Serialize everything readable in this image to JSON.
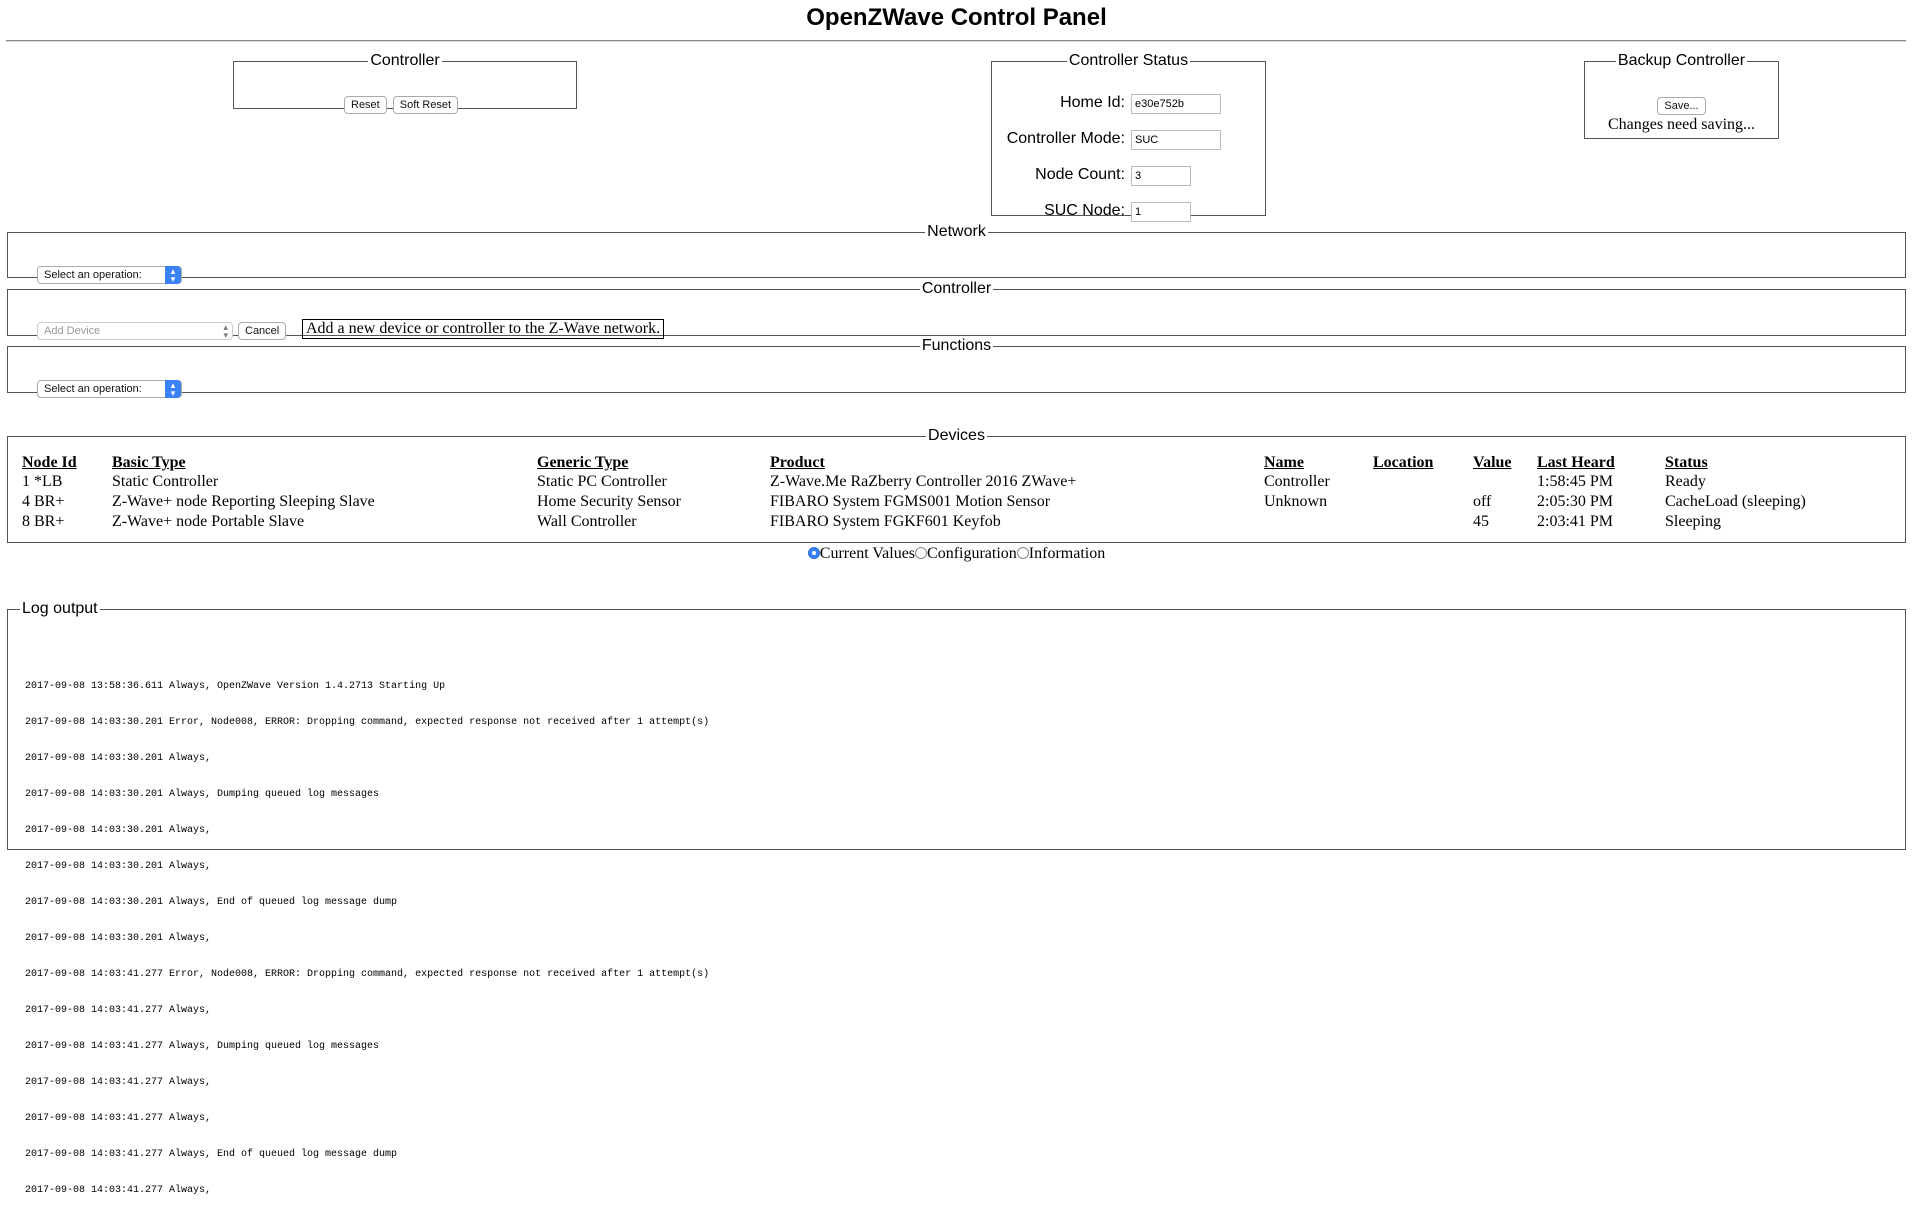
{
  "page": {
    "title": "OpenZWave Control Panel"
  },
  "controller_panel": {
    "legend": "Controller",
    "reset_label": "Reset",
    "soft_reset_label": "Soft Reset"
  },
  "controller_status": {
    "legend": "Controller Status",
    "home_id_label": "Home Id:",
    "home_id": "e30e752b",
    "mode_label": "Controller Mode:",
    "mode": "SUC",
    "node_count_label": "Node Count:",
    "node_count": "3",
    "suc_node_label": "SUC Node:",
    "suc_node": "1"
  },
  "backup_controller": {
    "legend": "Backup Controller",
    "save_label": "Save...",
    "message": "Changes need saving..."
  },
  "network": {
    "legend": "Network",
    "select_value": "Select an operation:"
  },
  "controller_ops": {
    "legend": "Controller",
    "select_value": "Add Device",
    "cancel_label": "Cancel",
    "description": "Add a new device or controller to the Z-Wave network."
  },
  "functions": {
    "legend": "Functions",
    "select_value": "Select an operation:"
  },
  "devices": {
    "legend": "Devices",
    "headers": {
      "node_id": "Node Id",
      "basic_type": "Basic Type",
      "generic_type": "Generic Type",
      "product": "Product",
      "name": "Name",
      "location": "Location",
      "value": "Value",
      "last_heard": "Last Heard",
      "status": "Status"
    },
    "rows": [
      {
        "node_id": "1 *LB",
        "basic_type": "Static Controller",
        "generic_type": "Static PC Controller",
        "product": "Z-Wave.Me RaZberry Controller 2016 ZWave+",
        "name": "Controller",
        "location": "",
        "value": "",
        "last_heard": "1:58:45 PM",
        "status": "Ready"
      },
      {
        "node_id": "4 BR+",
        "basic_type": "Z-Wave+ node Reporting Sleeping Slave",
        "generic_type": "Home Security Sensor",
        "product": "FIBARO System FGMS001 Motion Sensor",
        "name": "Unknown",
        "location": "",
        "value": "off",
        "last_heard": "2:05:30 PM",
        "status": "CacheLoad (sleeping)"
      },
      {
        "node_id": "8 BR+",
        "basic_type": "Z-Wave+ node Portable Slave",
        "generic_type": "Wall Controller",
        "product": "FIBARO System FGKF601 Keyfob",
        "name": "",
        "location": "",
        "value": "45",
        "last_heard": "2:03:41 PM",
        "status": "Sleeping"
      }
    ]
  },
  "view_options": {
    "selected": "Current Values",
    "options": [
      "Current Values",
      "Configuration",
      "Information"
    ]
  },
  "log": {
    "legend": "Log output",
    "lines": [
      "2017-09-08 13:58:36.611 Always, OpenZWave Version 1.4.2713 Starting Up",
      "2017-09-08 14:03:30.201 Error, Node008, ERROR: Dropping command, expected response not received after 1 attempt(s)",
      "2017-09-08 14:03:30.201 Always,",
      "2017-09-08 14:03:30.201 Always, Dumping queued log messages",
      "2017-09-08 14:03:30.201 Always,",
      "2017-09-08 14:03:30.201 Always,",
      "2017-09-08 14:03:30.201 Always, End of queued log message dump",
      "2017-09-08 14:03:30.201 Always,",
      "2017-09-08 14:03:41.277 Error, Node008, ERROR: Dropping command, expected response not received after 1 attempt(s)",
      "2017-09-08 14:03:41.277 Always,",
      "2017-09-08 14:03:41.277 Always, Dumping queued log messages",
      "2017-09-08 14:03:41.277 Always,",
      "2017-09-08 14:03:41.277 Always,",
      "2017-09-08 14:03:41.277 Always, End of queued log message dump",
      "2017-09-08 14:03:41.277 Always,"
    ]
  },
  "colors": {
    "accent": "#3b82f6",
    "border": "#555555"
  }
}
